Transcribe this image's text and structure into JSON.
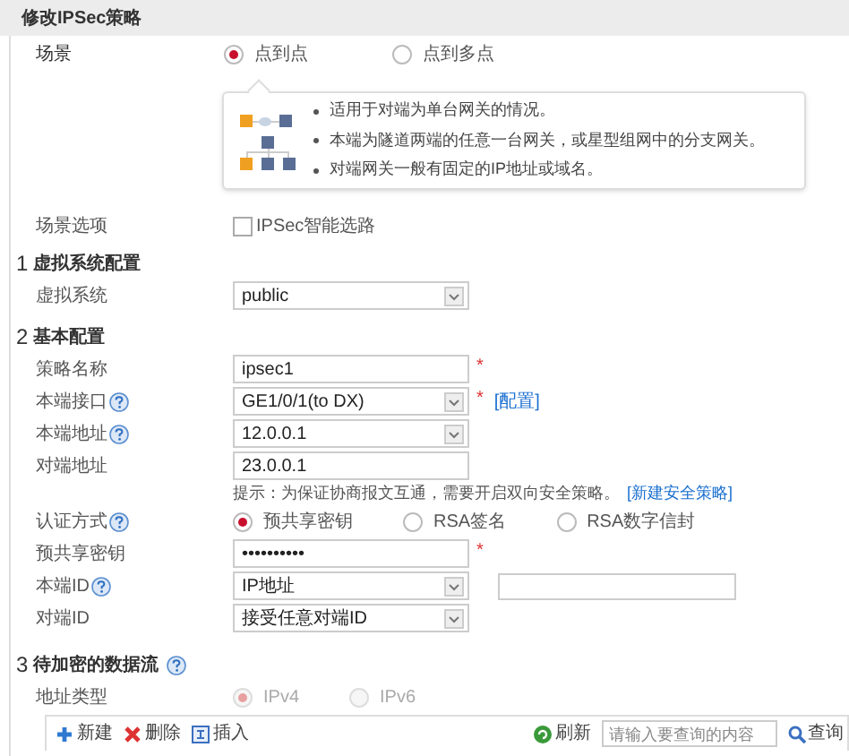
{
  "title": "修改IPSec策略",
  "scenario": {
    "label": "场景",
    "options": [
      {
        "label": "点到点",
        "selected": true
      },
      {
        "label": "点到多点",
        "selected": false
      }
    ],
    "info": [
      "适用于对端为单台网关的情况。",
      "本端为隧道两端的任意一台网关，或星型组网中的分支网关。",
      "对端网关一般有固定的IP地址或域名。"
    ]
  },
  "scenario_option": {
    "label": "场景选项",
    "checkbox": {
      "label": "IPSec智能选路",
      "checked": false
    }
  },
  "sections": [
    {
      "number": "1",
      "title": "虚拟系统配置",
      "help": false,
      "fields": [
        {
          "kind": "select",
          "label": "虚拟系统",
          "value": "public"
        }
      ]
    },
    {
      "number": "2",
      "title": "基本配置",
      "help": false,
      "fields": [
        {
          "kind": "input",
          "label": "策略名称",
          "value": "ipsec1",
          "mark": "*"
        },
        {
          "kind": "select",
          "label": "本端接口",
          "help": true,
          "value": "GE1/0/1(to DX)",
          "mark": "*",
          "link": "[配置]"
        },
        {
          "kind": "select",
          "label": "本端地址",
          "help": true,
          "value": "12.0.0.1"
        },
        {
          "kind": "input",
          "label": "对端地址",
          "value": "23.0.0.1"
        },
        {
          "kind": "hint",
          "text": "提示：为保证协商报文互通，需要开启双向安全策略。",
          "link": "[新建安全策略]"
        },
        {
          "kind": "radio",
          "label": "认证方式",
          "help": true,
          "disabled": false,
          "options": [
            {
              "label": "预共享密钥",
              "selected": true
            },
            {
              "label": "RSA签名",
              "selected": false
            },
            {
              "label": "RSA数字信封",
              "selected": false
            }
          ]
        },
        {
          "kind": "input",
          "label": "预共享密钥",
          "value": "••••••••••",
          "mark": "*"
        },
        {
          "kind": "select_input",
          "label": "本端ID",
          "help": true,
          "value": "IP地址"
        },
        {
          "kind": "select",
          "label": "对端ID",
          "value": "接受任意对端ID"
        }
      ]
    },
    {
      "number": "3",
      "title": "待加密的数据流",
      "help": true,
      "fields": [
        {
          "kind": "radio",
          "label": "地址类型",
          "disabled": true,
          "options": [
            {
              "label": "IPv4",
              "selected": true
            },
            {
              "label": "IPv6",
              "selected": false
            }
          ]
        }
      ]
    }
  ],
  "toolbar": {
    "buttons": [
      {
        "kind": "new",
        "label": "新建"
      },
      {
        "kind": "delete",
        "label": "删除"
      },
      {
        "kind": "insert",
        "label": "插入"
      }
    ],
    "refresh": "刷新",
    "search_placeholder": "请输入要查询的内容",
    "query": "查询"
  }
}
